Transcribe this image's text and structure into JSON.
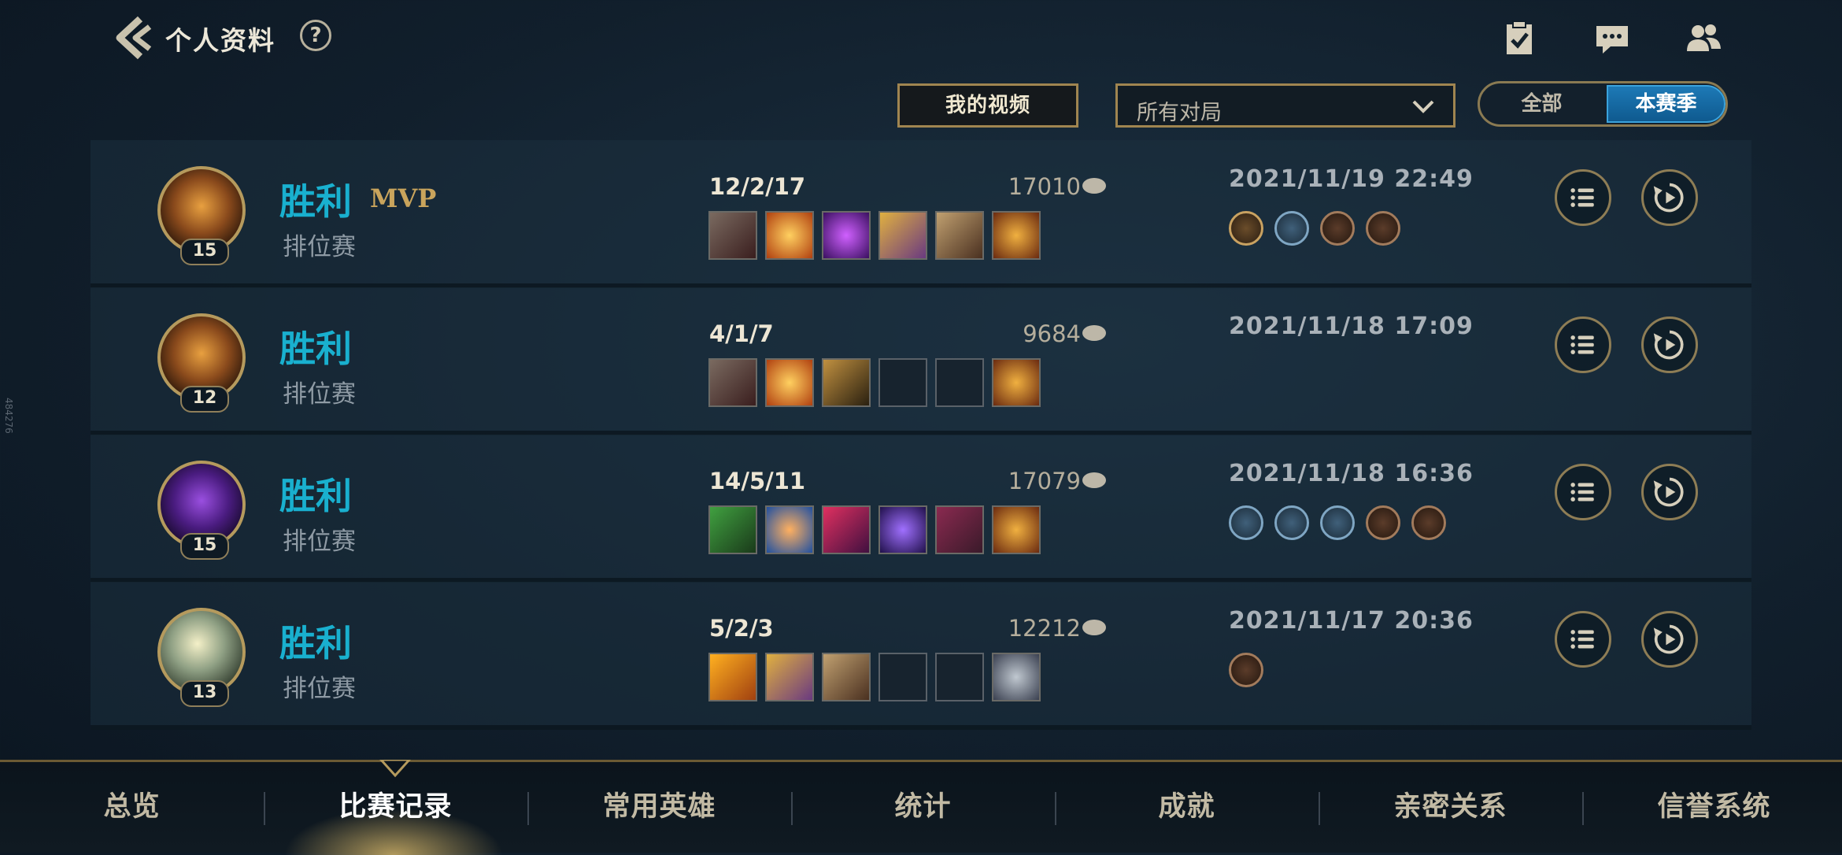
{
  "header": {
    "title": "个人资料",
    "help_label": "?"
  },
  "controls": {
    "video_button": "我的视频",
    "filter_value": "所有对局",
    "toggle_all": "全部",
    "toggle_season": "本赛季"
  },
  "side_id": "484276",
  "matches": [
    {
      "level": "15",
      "result": "胜利",
      "mvp": "MVP",
      "mode": "排位赛",
      "kda": "12/2/17",
      "gold": "17010",
      "datetime": "2021/11/19 22:49",
      "items": [
        "armor-item",
        "fire-item",
        "void-item",
        "sword-item",
        "gauntlet-item",
        "trinket-item"
      ],
      "badges": [
        "s-rank-badge",
        "flag-badge",
        "bronze-badge",
        "bronze-badge"
      ]
    },
    {
      "level": "12",
      "result": "胜利",
      "mode": "排位赛",
      "kda": "4/1/7",
      "gold": "9684",
      "datetime": "2021/11/18 17:09",
      "items": [
        "armor-item",
        "fire-item",
        "boots-item",
        "empty",
        "empty",
        "trinket-item"
      ],
      "badges": []
    },
    {
      "level": "15",
      "result": "胜利",
      "mode": "排位赛",
      "kda": "14/5/11",
      "gold": "17079",
      "datetime": "2021/11/18 16:36",
      "items": [
        "claw-item",
        "eye-item",
        "blade-item",
        "staff-item",
        "tome-item",
        "trinket-item"
      ],
      "badges": [
        "blue-badge",
        "blue-badge",
        "blue-badge",
        "bronze-badge",
        "bronze-badge"
      ]
    },
    {
      "level": "13",
      "result": "胜利",
      "mode": "排位赛",
      "kda": "5/2/3",
      "gold": "12212",
      "datetime": "2021/11/17 20:36",
      "items": [
        "lightning-item",
        "sword-item",
        "gauntlet-item",
        "empty",
        "empty",
        "ward-item"
      ],
      "badges": [
        "bronze-badge"
      ]
    }
  ],
  "nav": {
    "tabs": [
      "总览",
      "比赛记录",
      "常用英雄",
      "统计",
      "成就",
      "亲密关系",
      "信誉系统"
    ],
    "active_index": 1
  },
  "colors": {
    "victory": "#19b0cf",
    "mvp": "#c9a45c",
    "accent_blue": "#1d79b6",
    "border_gold": "#a08550"
  }
}
